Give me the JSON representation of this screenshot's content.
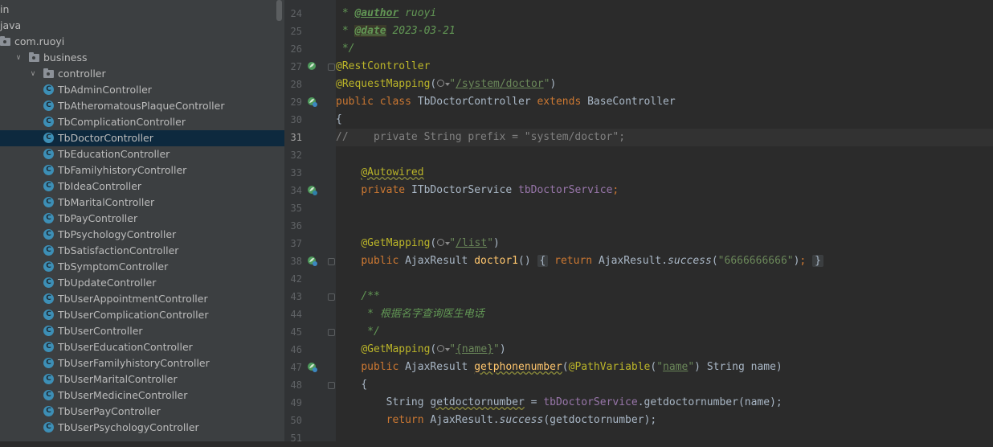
{
  "project_tree": {
    "items": [
      {
        "label": "in",
        "kind": "text"
      },
      {
        "label": "java",
        "kind": "text"
      },
      {
        "label": "com.ruoyi",
        "kind": "package"
      },
      {
        "label": "business",
        "kind": "package",
        "expanded": true
      },
      {
        "label": "controller",
        "kind": "package",
        "expanded": true
      },
      {
        "label": "TbAdminController",
        "kind": "class"
      },
      {
        "label": "TbAtheromatousPlaqueController",
        "kind": "class"
      },
      {
        "label": "TbComplicationController",
        "kind": "class"
      },
      {
        "label": "TbDoctorController",
        "kind": "class",
        "selected": true
      },
      {
        "label": "TbEducationController",
        "kind": "class"
      },
      {
        "label": "TbFamilyhistoryController",
        "kind": "class"
      },
      {
        "label": "TbIdeaController",
        "kind": "class"
      },
      {
        "label": "TbMaritalController",
        "kind": "class"
      },
      {
        "label": "TbPayController",
        "kind": "class"
      },
      {
        "label": "TbPsychologyController",
        "kind": "class"
      },
      {
        "label": "TbSatisfactionController",
        "kind": "class"
      },
      {
        "label": "TbSymptomController",
        "kind": "class"
      },
      {
        "label": "TbUpdateController",
        "kind": "class"
      },
      {
        "label": "TbUserAppointmentController",
        "kind": "class"
      },
      {
        "label": "TbUserComplicationController",
        "kind": "class"
      },
      {
        "label": "TbUserController",
        "kind": "class"
      },
      {
        "label": "TbUserEducationController",
        "kind": "class"
      },
      {
        "label": "TbUserFamilyhistoryController",
        "kind": "class"
      },
      {
        "label": "TbUserMaritalController",
        "kind": "class"
      },
      {
        "label": "TbUserMedicineController",
        "kind": "class"
      },
      {
        "label": "TbUserPayController",
        "kind": "class"
      },
      {
        "label": "TbUserPsychologyController",
        "kind": "class"
      }
    ],
    "class_icon_letter": "C"
  },
  "editor": {
    "current_line": 31,
    "line_numbers": [
      "24",
      "25",
      "26",
      "27",
      "28",
      "29",
      "30",
      "31",
      "32",
      "33",
      "34",
      "35",
      "36",
      "37",
      "38",
      "42",
      "43",
      "44",
      "45",
      "46",
      "47",
      "48",
      "49",
      "50",
      "51"
    ],
    "gutter_icons": {
      "27": "bean-icon",
      "29": "bean-run-icon",
      "34": "autowired-icon",
      "38": "mapping-icon",
      "47": "mapping-icon"
    },
    "code": {
      "l24_tag": "@author",
      "l24_val": "ruoyi",
      "l25_tag": "@date",
      "l25_val": "2023-03-21",
      "l26": " */",
      "l27": "@RestController",
      "l28_ann": "@RequestMapping",
      "l28_path": "/system/doctor",
      "l29_public": "public",
      "l29_class": "class",
      "l29_name": "TbDoctorController",
      "l29_extends": "extends",
      "l29_base": "BaseController",
      "l30": "{",
      "l31": "//    private String prefix = \"system/doctor\";",
      "l33": "@Autowired",
      "l34_private": "private",
      "l34_type": "ITbDoctorService",
      "l34_field": "tbDoctorService",
      "l37_ann": "@GetMapping",
      "l37_path": "/list",
      "l38_public": "public",
      "l38_type": "AjaxResult",
      "l38_method": "doctor1",
      "l38_return": "return",
      "l38_call": "AjaxResult.",
      "l38_success": "success",
      "l38_str": "\"6666666666\"",
      "l43": "/**",
      "l44": " * 根据名字查询医生电话",
      "l45": " */",
      "l46_ann": "@GetMapping",
      "l46_path": "{name}",
      "l47_public": "public",
      "l47_type": "AjaxResult",
      "l47_method": "getphonenumber",
      "l47_ann": "@PathVariable",
      "l47_str": "name",
      "l47_rest": "String name)",
      "l48": "{",
      "l49_type": "String",
      "l49_var": "getdoctornumber",
      "l49_field": "tbDoctorService",
      "l49_rest": ".getdoctornumber(name);",
      "l50_return": "return",
      "l50_call": "AjaxResult.",
      "l50_success": "success",
      "l50_rest": "(getdoctornumber);"
    }
  },
  "colors": {
    "keyword": "#cc7832",
    "annotation": "#bbb529",
    "string": "#6a8759",
    "comment": "#808080",
    "field": "#9876aa",
    "doc": "#629755"
  }
}
